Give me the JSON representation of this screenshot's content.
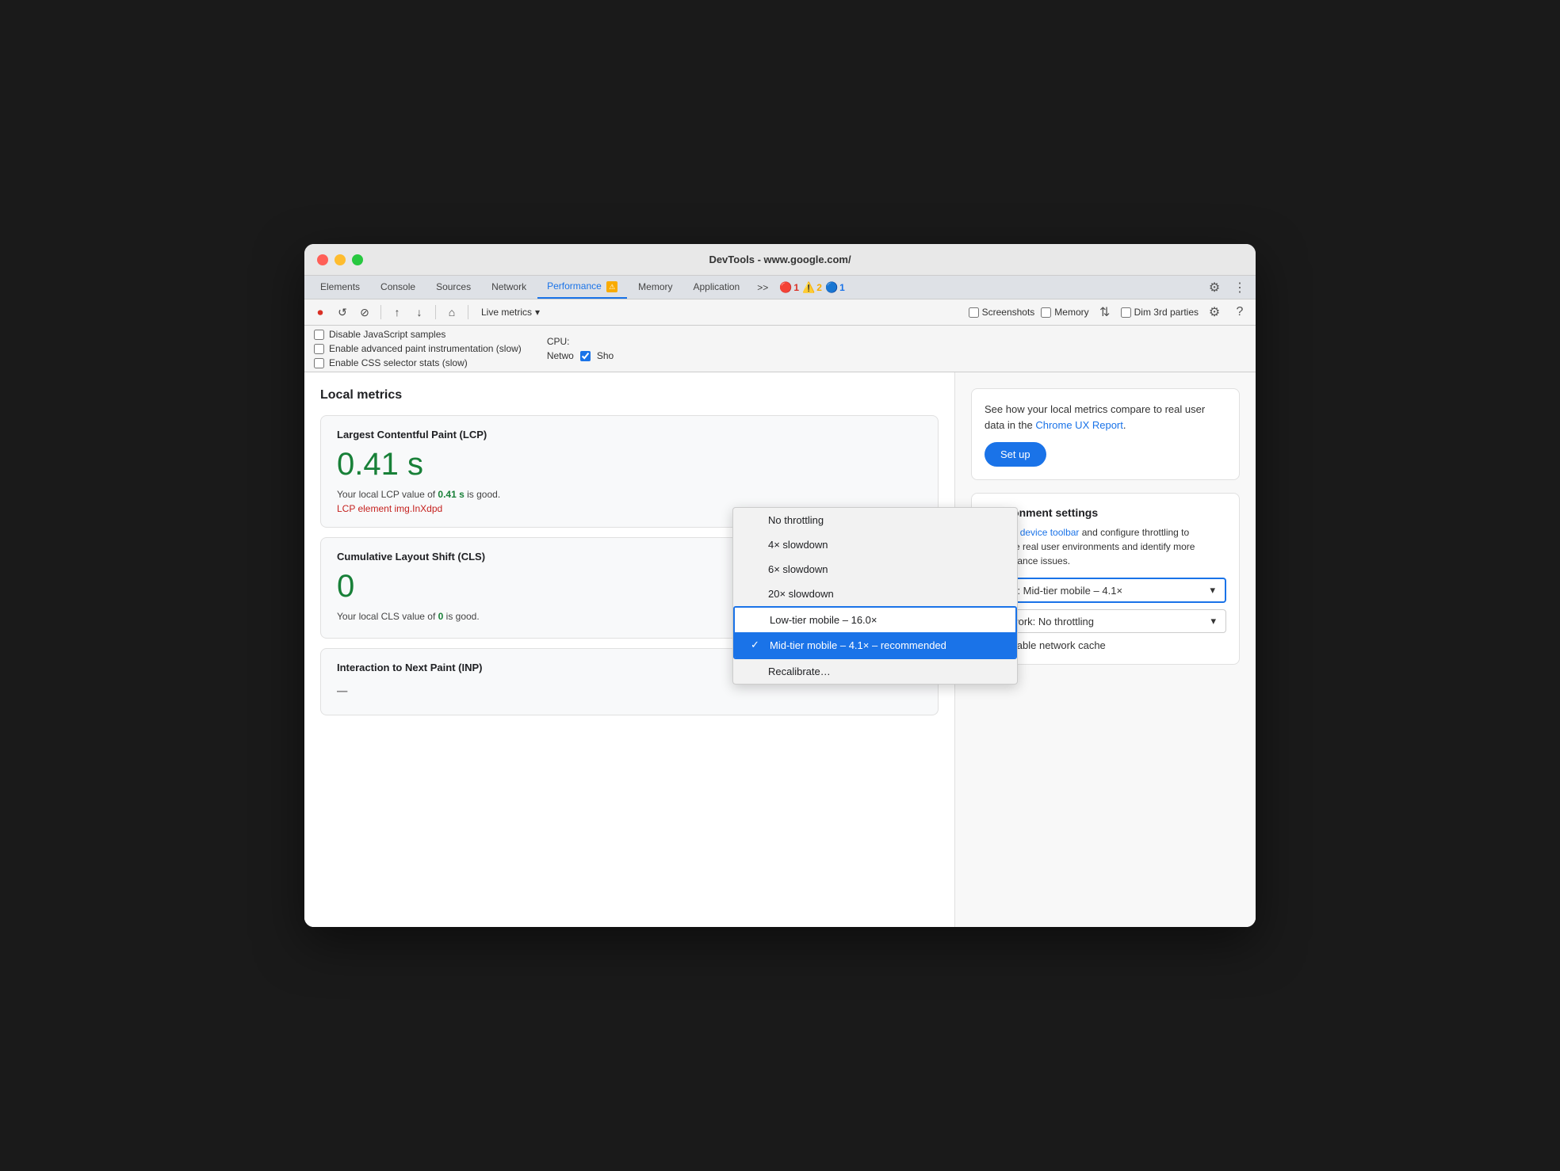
{
  "window": {
    "title": "DevTools - www.google.com/"
  },
  "tabs": {
    "items": [
      {
        "label": "Elements",
        "active": false
      },
      {
        "label": "Console",
        "active": false
      },
      {
        "label": "Sources",
        "active": false
      },
      {
        "label": "Network",
        "active": false
      },
      {
        "label": "Performance",
        "active": true,
        "warning": true
      },
      {
        "label": "Memory",
        "active": false
      },
      {
        "label": "Application",
        "active": false
      },
      {
        "label": ">>",
        "active": false
      }
    ],
    "errors": {
      "red_count": "1",
      "yellow_count": "2",
      "blue_count": "1"
    }
  },
  "toolbar": {
    "live_metrics_label": "Live metrics",
    "screenshots_label": "Screenshots",
    "memory_label": "Memory",
    "dim_3rd_parties_label": "Dim 3rd parties"
  },
  "settings": {
    "disable_js_label": "Disable JavaScript samples",
    "enable_paint_label": "Enable advanced paint instrumentation (slow)",
    "enable_css_label": "Enable CSS selector stats (slow)",
    "cpu_label": "CPU:",
    "network_label": "Netwo"
  },
  "cpu_dropdown": {
    "items": [
      {
        "label": "No throttling",
        "selected": false,
        "check": ""
      },
      {
        "label": "4× slowdown",
        "selected": false,
        "check": ""
      },
      {
        "label": "6× slowdown",
        "selected": false,
        "check": ""
      },
      {
        "label": "20× slowdown",
        "selected": false,
        "check": ""
      },
      {
        "label": "Low-tier mobile – 16.0×",
        "selected": false,
        "check": "",
        "highlighted": true
      },
      {
        "label": "Mid-tier mobile – 4.1× – recommended",
        "selected": true,
        "check": "✓"
      },
      {
        "label": "Recalibrate…",
        "selected": false,
        "check": ""
      }
    ]
  },
  "local_metrics": {
    "title": "Local metrics",
    "cards": [
      {
        "name": "Largest Contentful Paint (LCP)",
        "value": "0.41 s",
        "desc_prefix": "Your local LCP value of ",
        "desc_highlight": "0.41 s",
        "desc_suffix": " is good.",
        "element_prefix": "LCP element ",
        "element_value": "img.InXdpd"
      },
      {
        "name": "Cumulative Layout Shift (CLS)",
        "value": "0",
        "desc_prefix": "Your local CLS value of ",
        "desc_highlight": "0",
        "desc_suffix": " is good.",
        "element_prefix": "",
        "element_value": ""
      },
      {
        "name": "Interaction to Next Paint (INP)",
        "value": "–",
        "desc_prefix": "",
        "desc_highlight": "",
        "desc_suffix": "",
        "element_prefix": "",
        "element_value": ""
      }
    ]
  },
  "right_panel": {
    "ux_text_before": "See how your local metrics compare to real user data in the ",
    "ux_link": "Chrome UX Report",
    "ux_text_after": ".",
    "setup_btn": "Set up",
    "env_title": "Environment settings",
    "env_desc": "Use the device toolbar and configure throttling to simulate real user environments and identify more performance issues.",
    "env_device_link": "device toolbar",
    "cpu_select_label": "CPU: Mid-tier mobile – 4.1×",
    "network_select_label": "Network: No throttling",
    "disable_cache_label": "Disable network cache"
  }
}
